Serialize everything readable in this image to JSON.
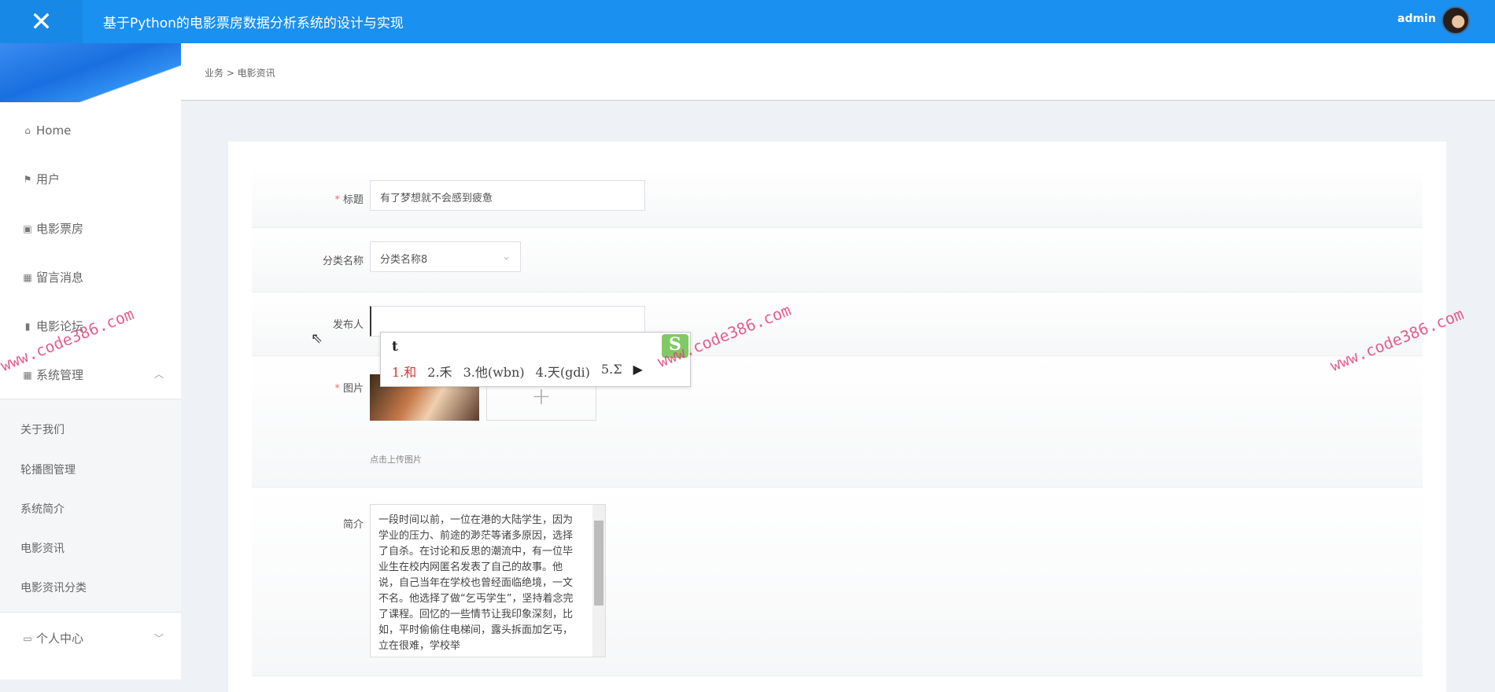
{
  "header": {
    "close_icon": "close-icon",
    "title": "基于Python的电影票房数据分析系统的设计与实现",
    "user": "admin"
  },
  "breadcrumb": "业务 > 电影资讯",
  "sidebar": {
    "items": [
      {
        "label": "Home",
        "icon": "home-icon"
      },
      {
        "label": "用户",
        "icon": "flag-icon"
      },
      {
        "label": "电影票房",
        "icon": "chart-icon"
      },
      {
        "label": "留言消息",
        "icon": "grid-icon"
      },
      {
        "label": "电影论坛",
        "icon": "bar-chart-icon"
      },
      {
        "label": "系统管理",
        "icon": "grid-icon"
      }
    ],
    "sub_items": [
      "关于我们",
      "轮播图管理",
      "系统简介",
      "电影资讯",
      "电影资讯分类"
    ],
    "personal": "个人中心"
  },
  "form": {
    "title_label": "标题",
    "title_value": "有了梦想就不会感到疲惫",
    "category_label": "分类名称",
    "category_value": "分类名称8",
    "publisher_label": "发布人",
    "publisher_value": "",
    "image_label": "图片",
    "upload_hint": "点击上传图片",
    "intro_label": "简介",
    "intro_value": "一段时间以前，一位在港的大陆学生，因为学业的压力、前途的渺茫等诸多原因，选择了自杀。在讨论和反思的潮流中，有一位毕业生在校内网匿名发表了自己的故事。他说，自己当年在学校也曾经面临绝境，一文不名。他选择了做“乞丐学生”，坚持着念完了课程。回忆的一些情节让我印象深刻，比如，平时偷偷住电梯间，露头拆面加乞丐，立在很难，学校举"
  },
  "ime": {
    "input": "t",
    "candidates": [
      "1.和",
      "2.禾",
      "3.他(wbn)",
      "4.天(gdi)",
      "5.Σ"
    ]
  },
  "watermark": "www.code386.com"
}
